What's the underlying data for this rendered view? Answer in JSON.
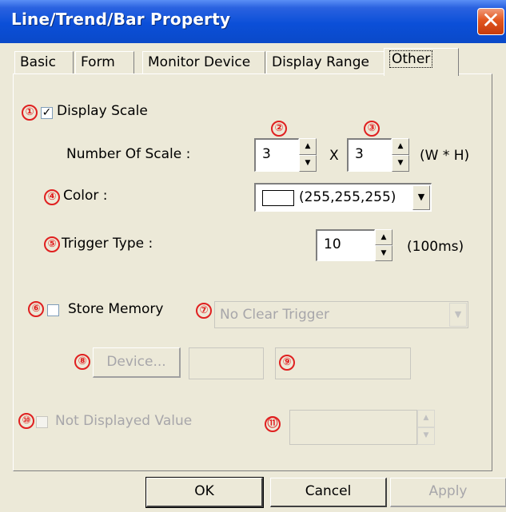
{
  "window": {
    "title": "Line/Trend/Bar Property",
    "close_glyph": "✕"
  },
  "tabs": [
    {
      "label": "Basic"
    },
    {
      "label": "Form"
    },
    {
      "label": "Monitor Device"
    },
    {
      "label": "Display Range"
    },
    {
      "label": "Other",
      "active": true
    }
  ],
  "markers": [
    "①",
    "②",
    "③",
    "④",
    "⑤",
    "⑥",
    "⑦",
    "⑧",
    "⑨",
    "⑩",
    "⑪"
  ],
  "display_scale": {
    "label": "Display Scale",
    "checked": true,
    "check_glyph": "✓"
  },
  "number_of_scale": {
    "label": "Number Of Scale :",
    "width_value": "3",
    "height_value": "3",
    "separator": "X",
    "unit": "(W * H)"
  },
  "color": {
    "label": "Color :",
    "value": "(255,255,255)",
    "swatch": "#ffffff"
  },
  "trigger_type": {
    "label": "Trigger Type :",
    "value": "10",
    "unit": "(100ms)"
  },
  "store_memory": {
    "label": "Store Memory",
    "checked": false,
    "clear_trigger": "No Clear Trigger"
  },
  "device": {
    "button_label": "Device...",
    "field1": "",
    "field2": ""
  },
  "not_displayed": {
    "label": "Not Displayed Value",
    "checked": false,
    "value": ""
  },
  "buttons": {
    "ok": "OK",
    "cancel": "Cancel",
    "apply": "Apply"
  },
  "spin_glyphs": {
    "up": "▲",
    "down": "▼"
  },
  "combo_glyph": "▼",
  "colors": {
    "accent": "#0b4fd8",
    "marker": "#e02020",
    "face": "#ece9d8",
    "disabled": "#a7a6aa"
  }
}
